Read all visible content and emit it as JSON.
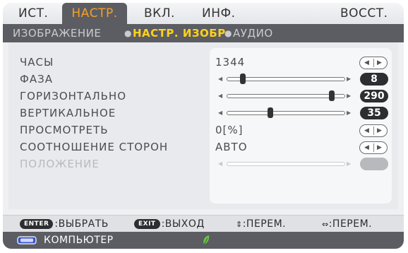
{
  "tabs": [
    "ИСТ.",
    "НАСТР.",
    "ВКЛ.",
    "ИНФ.",
    "ВОССТ."
  ],
  "active_tab": "НАСТР.",
  "breadcrumbs": {
    "item1": "ИЗОБРАЖЕНИЕ",
    "item2": "НАСТР. ИЗОБР",
    "item3": "АУДИО"
  },
  "rows": [
    {
      "label": "ЧАСЫ",
      "value": "1344",
      "control": "arrows"
    },
    {
      "label": "ФАЗА",
      "value": "8",
      "control": "slider",
      "level": 0.12
    },
    {
      "label": "ГОРИЗОНТАЛЬНО",
      "value": "290",
      "control": "slider",
      "level": 0.92
    },
    {
      "label": "ВЕРТИКАЛЬНОЕ",
      "value": "35",
      "control": "slider",
      "level": 0.37
    },
    {
      "label": "ПРОСМОТРЕТЬ",
      "value": "0[%]",
      "control": "arrows"
    },
    {
      "label": "СООТНОШЕНИЕ СТОРОН",
      "value": "АВТО",
      "control": "arrows"
    },
    {
      "label": "ПОЛОЖЕНИЕ",
      "value": "",
      "control": "slider-disabled"
    }
  ],
  "help": {
    "enter_key": "ENTER",
    "enter_text": ":ВЫБРАТЬ",
    "exit_key": "EXIT",
    "exit_text": ":ВЫХОД",
    "updown_text": ":ПЕРЕМ.",
    "leftright_text": ":ПЕРЕМ."
  },
  "status": {
    "source": "КОМПЬЮТЕР"
  },
  "colors": {
    "active_tab_text": "#f7a028",
    "current_crumb": "#ffd21e",
    "header_bg": "#5b5d63"
  },
  "icons": [
    "monitor-icon",
    "eco-leaf-icon",
    "up-down-arrows-icon",
    "left-right-arrows-icon"
  ]
}
